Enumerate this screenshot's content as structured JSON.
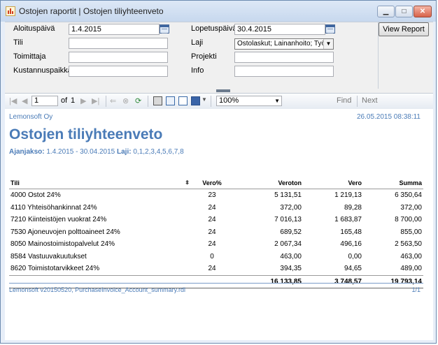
{
  "window": {
    "title": "Ostojen raportit | Ostojen tiliyhteenveto"
  },
  "params": {
    "start_label": "Aloituspäivä",
    "start_value": "1.4.2015",
    "end_label": "Lopetuspäivä",
    "end_value": "30.4.2015",
    "account_label": "Tili",
    "account_value": "",
    "type_label": "Laji",
    "type_value": "Ostolaskut; Lainanhoito; Työna",
    "supplier_label": "Toimittaja",
    "supplier_value": "",
    "project_label": "Projekti",
    "project_value": "",
    "costcenter_label": "Kustannuspaikka",
    "costcenter_value": "",
    "info_label": "Info",
    "info_value": "",
    "view_button": "View Report"
  },
  "toolbar": {
    "page": "1",
    "of_label": "of",
    "page_count": "1",
    "zoom": "100%",
    "find_label": "Find",
    "next_label": "Next"
  },
  "report": {
    "company": "Lemonsoft Oy",
    "datetime": "26.05.2015 08:38:11",
    "title": "Ostojen tiliyhteenveto",
    "period_label": "Ajanjakso:",
    "period_value": "1.4.2015 - 30.04.2015",
    "type_label": "Laji:",
    "type_value": "0,1,2,3,4,5,6,7,8",
    "columns": [
      "Tili",
      "Vero%",
      "Veroton",
      "Vero",
      "Summa"
    ],
    "rows": [
      [
        "4000 Ostot 24%",
        "23",
        "5 131,51",
        "1 219,13",
        "6 350,64"
      ],
      [
        "4110 Yhteisöhankinnat 24%",
        "24",
        "372,00",
        "89,28",
        "372,00"
      ],
      [
        "7210 Kiinteistöjen vuokrat 24%",
        "24",
        "7 016,13",
        "1 683,87",
        "8 700,00"
      ],
      [
        "7530 Ajoneuvojen polttoaineet 24%",
        "24",
        "689,52",
        "165,48",
        "855,00"
      ],
      [
        "8050 Mainostoimistopalvelut 24%",
        "24",
        "2 067,34",
        "496,16",
        "2 563,50"
      ],
      [
        "8584 Vastuuvakuutukset",
        "0",
        "463,00",
        "0,00",
        "463,00"
      ],
      [
        "8620 Toimistotarvikkeet 24%",
        "24",
        "394,35",
        "94,65",
        "489,00"
      ]
    ],
    "totals": {
      "veroton": "16 133,85",
      "vero": "3 748,57",
      "summa": "19 793,14"
    },
    "footer_left": "Lemonsoft v20150520, PurchaseInvoice_Account_summary.rdl",
    "footer_right": "1/1"
  }
}
